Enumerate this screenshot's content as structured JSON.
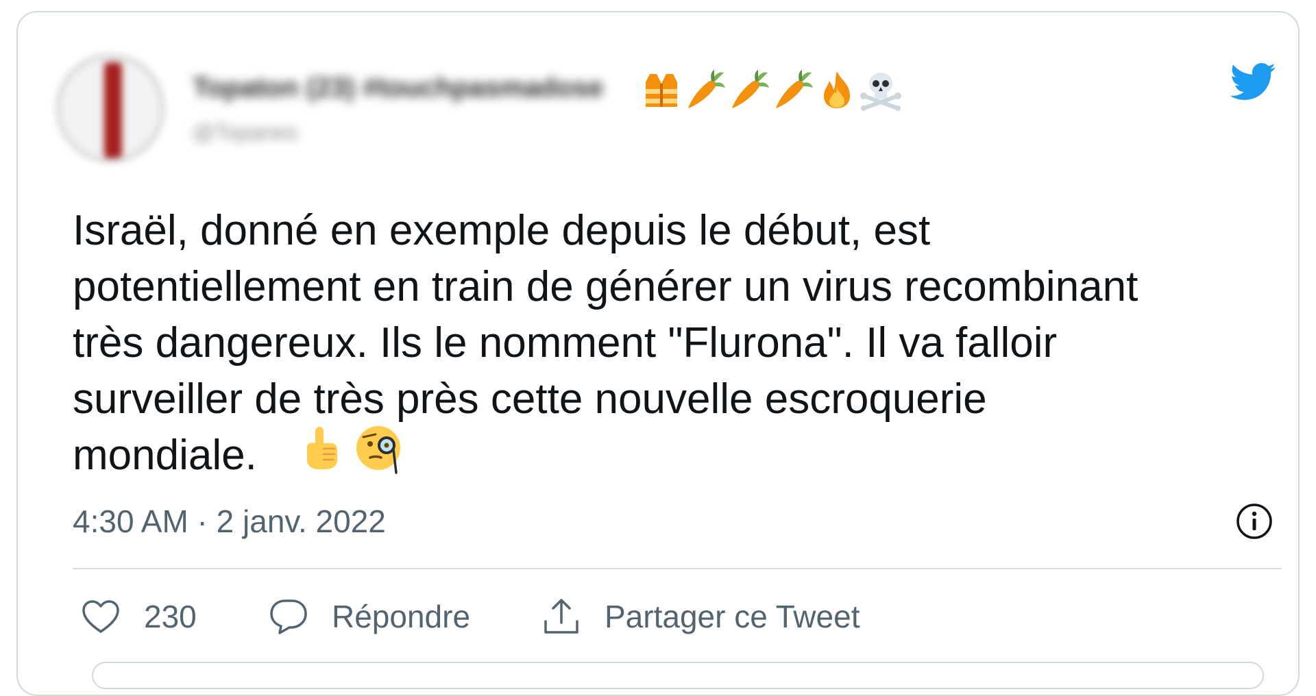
{
  "author": {
    "display_name": "Topaton (23) #touchpasmadose",
    "handle": "@Topanes"
  },
  "name_emojis": [
    "construction-worker-vest-icon",
    "carrot-icon",
    "carrot-icon",
    "carrot-icon",
    "fire-icon",
    "skull-crossbones-icon"
  ],
  "tweet": {
    "text": "Israël, donné en exemple depuis le début, est\npotentiellement en train de générer un virus recombinant\ntrès dangereux. Ils le nomment \"Flurona\". Il va falloir\nsurveiller de très près cette nouvelle escroquerie\nmondiale.",
    "emojis": [
      "pointing-up-icon",
      "face-with-monocle-icon"
    ],
    "timestamp": "4:30 AM · 2 janv. 2022"
  },
  "actions": {
    "like_count": "230",
    "reply_label": "Répondre",
    "share_label": "Partager ce Tweet"
  },
  "colors": {
    "twitter_blue": "#1d9bf0",
    "text": "#0f1419",
    "secondary_text": "#536471",
    "border": "#cfd9de"
  }
}
